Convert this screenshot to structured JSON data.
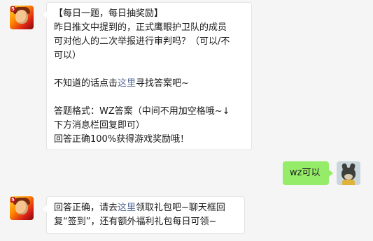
{
  "messages": [
    {
      "sender": "official",
      "lines": [
        "【每日一题，每日抽奖励】",
        "昨日推文中提到的，正式鹰眼护卫队的成员",
        "可对他人的二次举报进行审判吗？（可以/不",
        "可以）"
      ],
      "hint_before": "不知道的话点击",
      "hint_link": "这里",
      "hint_after": "寻找答案吧~",
      "format_lines": [
        "答题格式：WZ答案（中间不用加空格哦~↓",
        "下方消息栏回复即可）",
        "回答正确100%获得游戏奖励哦！"
      ]
    },
    {
      "sender": "user",
      "text": "wz可以"
    },
    {
      "sender": "official",
      "reply_before": "回答正确，请去",
      "reply_link": "这里",
      "reply_after": "领取礼包吧~聊天框回",
      "reply_line2": "复“签到”，还有额外福利礼包每日可领~"
    }
  ],
  "colors": {
    "background": "#f5f5f5",
    "user_bubble": "#95ec69",
    "link": "#576b95"
  }
}
